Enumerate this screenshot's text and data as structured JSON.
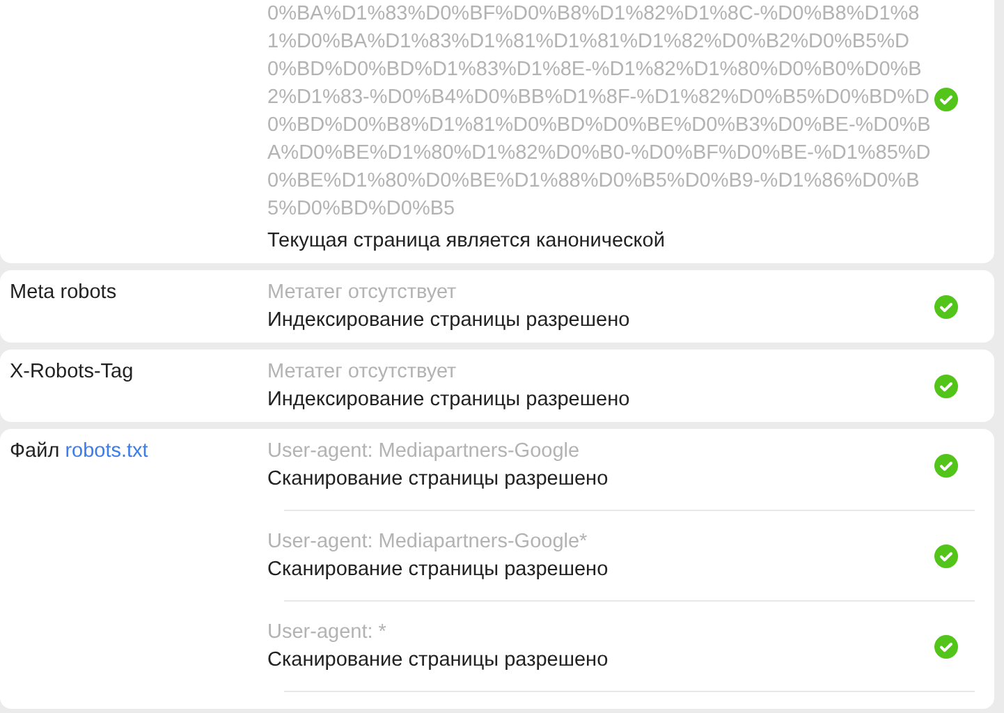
{
  "canonical": {
    "url_lines": [
      "0%BA%D1%83%D0%BF%D0%B8%D1%82%D1%8C-%D0%B8%D1%8",
      "1%D0%BA%D1%83%D1%81%D1%81%D1%82%D0%B2%D0%B5%D",
      "0%BD%D0%BD%D1%83%D1%8E-%D1%82%D1%80%D0%B0%D0%B",
      "2%D1%83-%D0%B4%D0%BB%D1%8F-%D1%82%D0%B5%D0%BD%D",
      "0%BD%D0%B8%D1%81%D0%BD%D0%BE%D0%B3%D0%BE-%D0%B",
      "A%D0%BE%D1%80%D1%82%D0%B0-%D0%BF%D0%BE-%D1%85%D",
      "0%BE%D1%80%D0%BE%D1%88%D0%B5%D0%B9-%D1%86%D0%B",
      "5%D0%BD%D0%B5"
    ],
    "result": "Текущая страница является канонической",
    "ok": true
  },
  "sections": [
    {
      "label": "Meta robots",
      "entries": [
        {
          "detail": "Метатег отсутствует",
          "result": "Индексирование страницы разрешено",
          "ok": true
        }
      ]
    },
    {
      "label": "X-Robots-Tag",
      "entries": [
        {
          "detail": "Метатег отсутствует",
          "result": "Индексирование страницы разрешено",
          "ok": true
        }
      ]
    },
    {
      "label": "Файл",
      "link": "robots.txt",
      "entries": [
        {
          "detail": "User-agent: Mediapartners-Google",
          "result": "Сканирование страницы разрешено",
          "ok": true
        },
        {
          "detail": "User-agent: Mediapartners-Google*",
          "result": "Сканирование страницы разрешено",
          "ok": true
        },
        {
          "detail": "User-agent: *",
          "result": "Сканирование страницы разрешено",
          "ok": true
        }
      ]
    }
  ]
}
